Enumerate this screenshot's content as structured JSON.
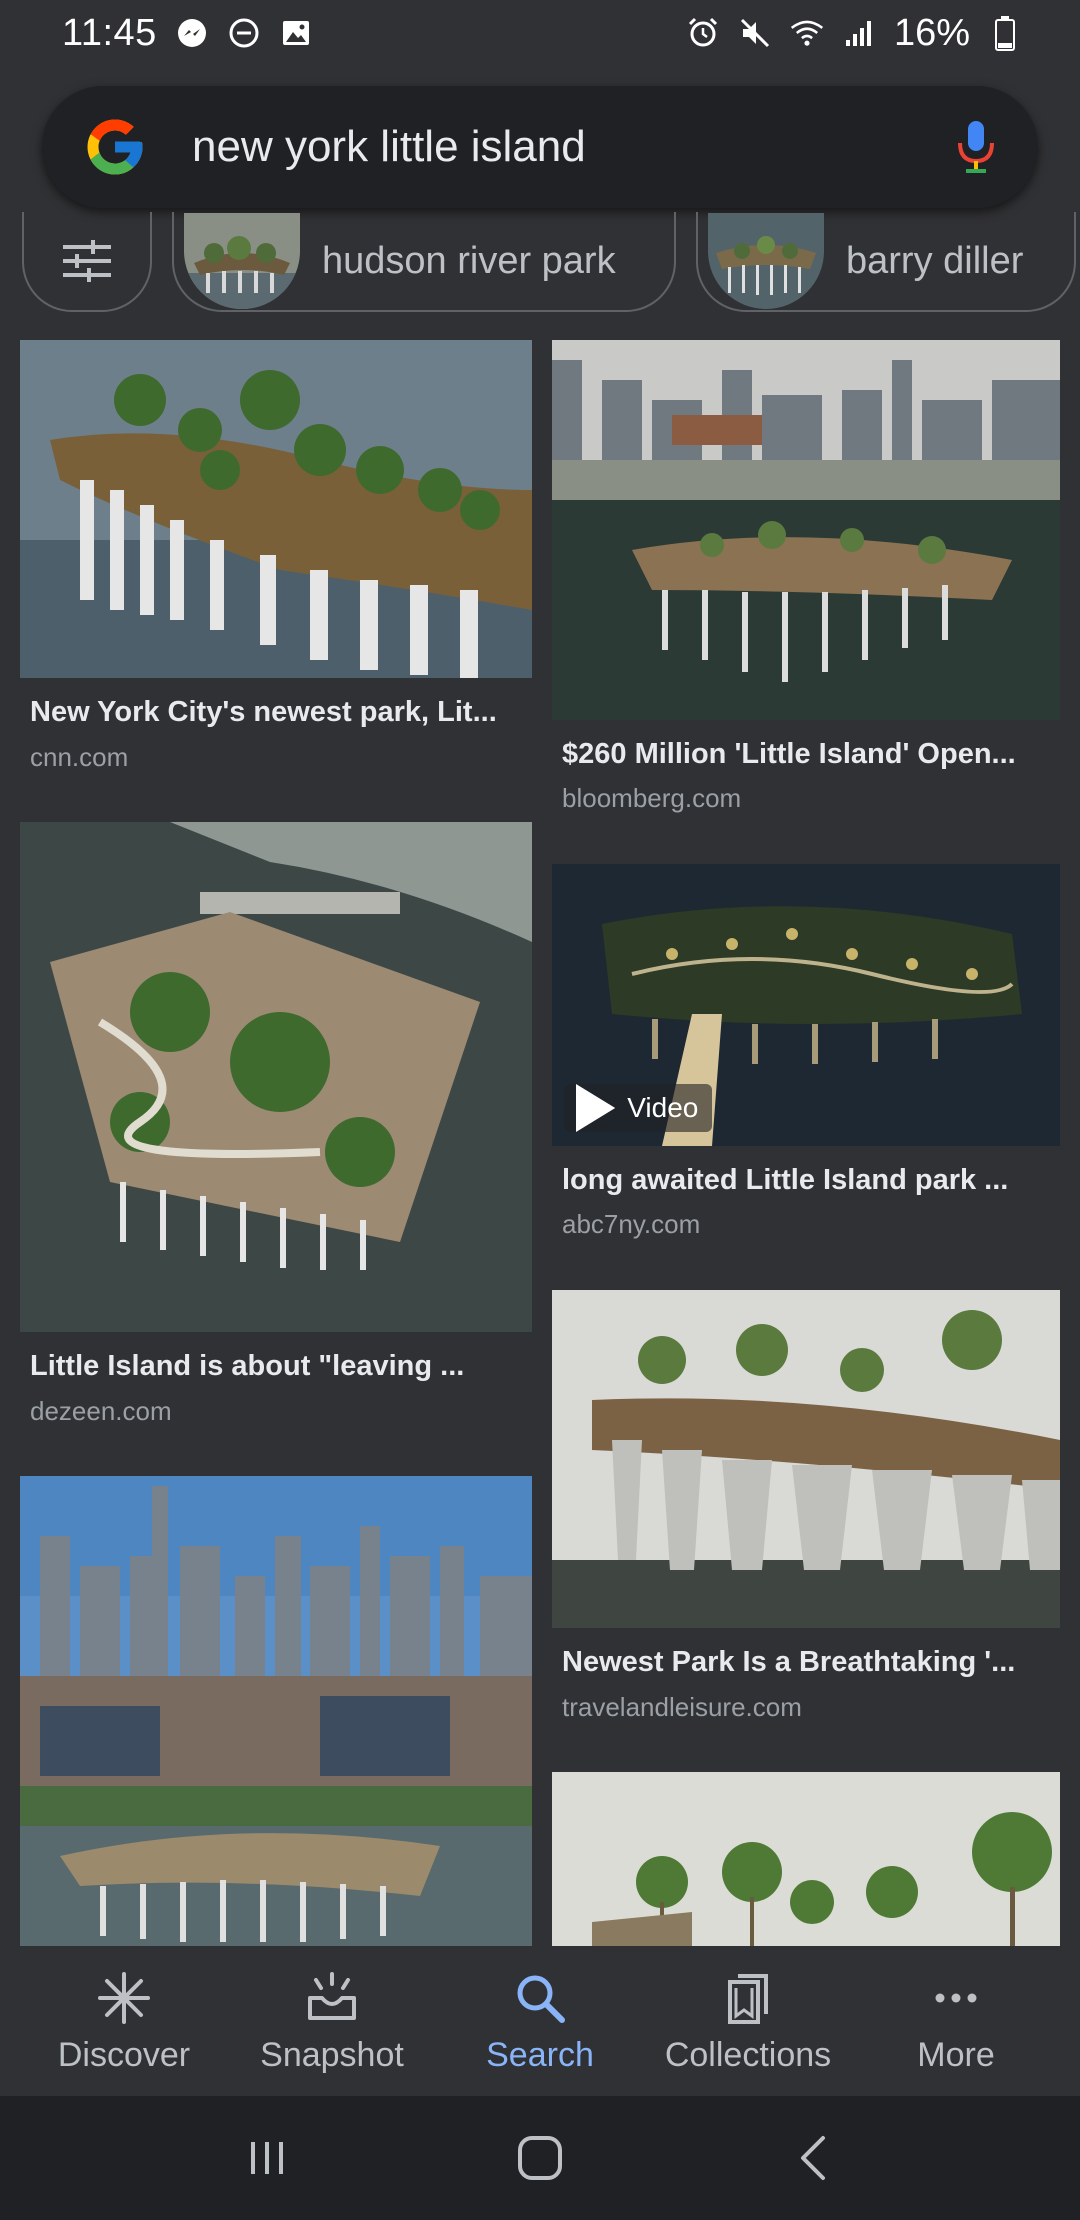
{
  "status_bar": {
    "time": "11:45",
    "battery_text": "16%",
    "left_icons": [
      "messenger-icon",
      "do-not-disturb-icon",
      "image-icon"
    ],
    "right_icons": [
      "alarm-icon",
      "mute-icon",
      "wifi-icon",
      "signal-icon",
      "battery-icon"
    ]
  },
  "search": {
    "query": "new york little island",
    "logo": "google-logo",
    "mic_icon": "mic-icon"
  },
  "chips": [
    {
      "type": "filter",
      "icon": "tune-icon"
    },
    {
      "type": "suggestion",
      "label": "hudson river park"
    },
    {
      "type": "suggestion",
      "label": "barry diller"
    }
  ],
  "results": [
    {
      "title": "New York City's newest park, Lit...",
      "source": "cnn.com",
      "video": false
    },
    {
      "title": "$260 Million 'Little Island' Open...",
      "source": "bloomberg.com",
      "video": false
    },
    {
      "title": "Little Island is about \"leaving ...",
      "source": "dezeen.com",
      "video": false
    },
    {
      "title": "long awaited Little Island park ...",
      "source": "abc7ny.com",
      "video": true,
      "video_label": "Video"
    },
    {
      "title": "Newest Park Is a Breathtaking '...",
      "source": "travelandleisure.com",
      "video": false
    },
    {
      "title": "",
      "source": "",
      "video": false
    },
    {
      "title": "",
      "source": "",
      "video": false
    }
  ],
  "bottom_nav": {
    "items": [
      {
        "label": "Discover",
        "icon": "discover-icon",
        "active": false
      },
      {
        "label": "Snapshot",
        "icon": "snapshot-icon",
        "active": false
      },
      {
        "label": "Search",
        "icon": "search-icon",
        "active": true
      },
      {
        "label": "Collections",
        "icon": "collections-icon",
        "active": false
      },
      {
        "label": "More",
        "icon": "more-icon",
        "active": false
      }
    ]
  },
  "colors": {
    "background": "#303134",
    "search_bar": "#202124",
    "accent": "#8ab4f8",
    "muted_text": "#9aa0a6"
  }
}
